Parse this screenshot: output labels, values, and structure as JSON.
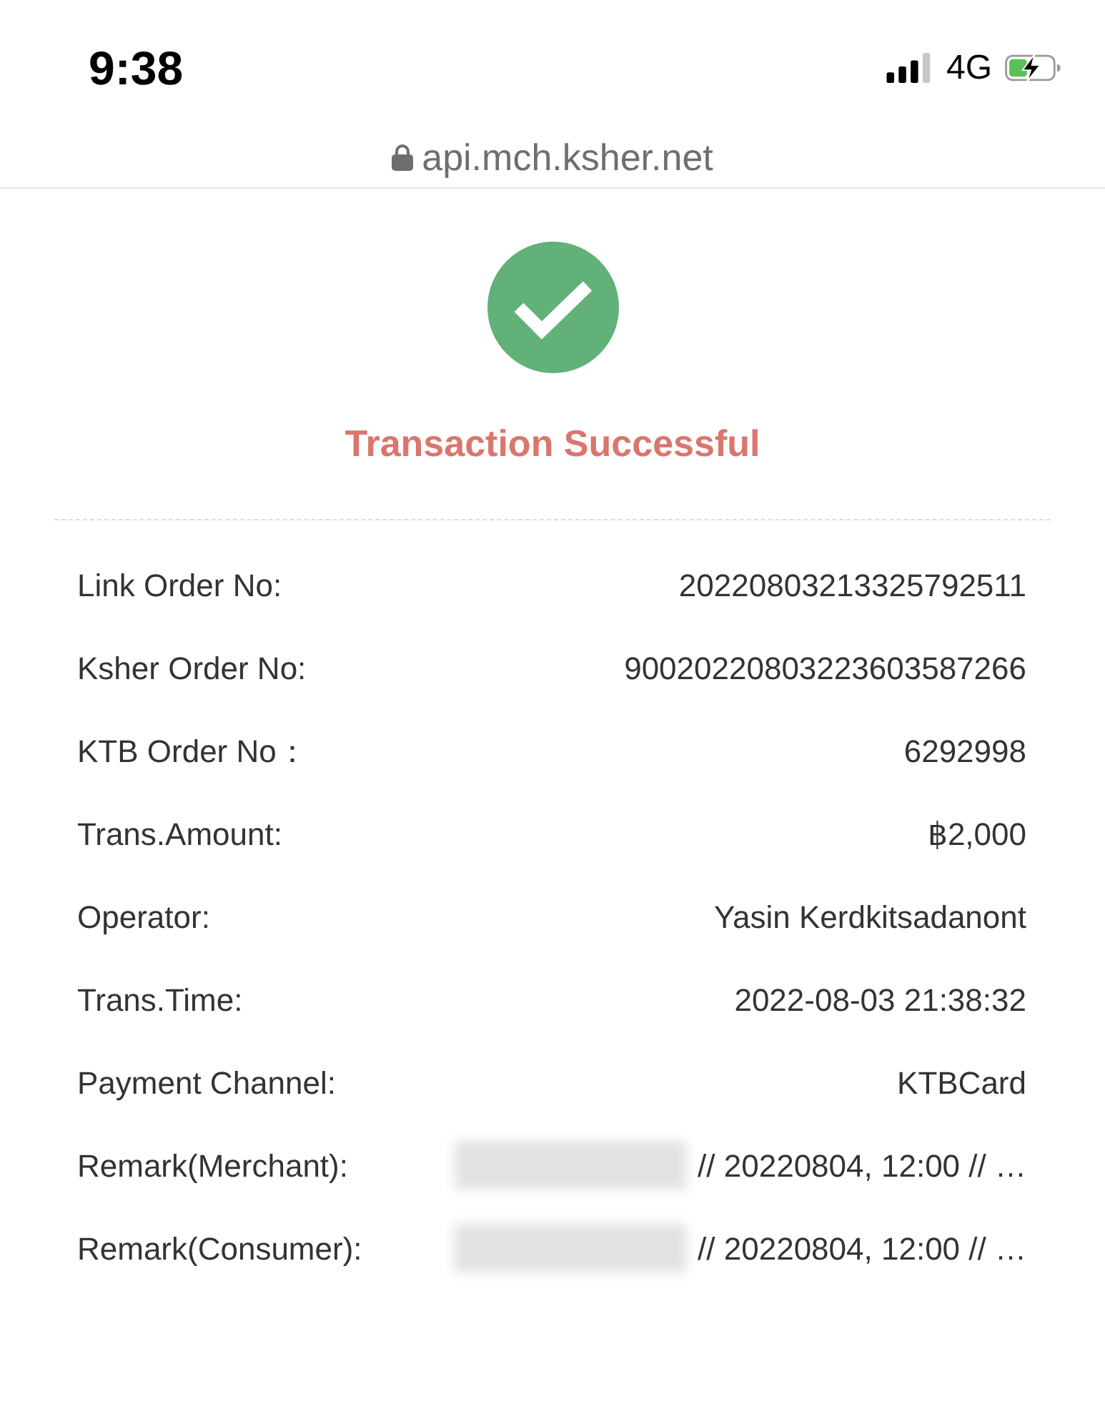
{
  "status_bar": {
    "time": "9:38",
    "network": "4G"
  },
  "address_bar": {
    "url": "api.mch.ksher.net"
  },
  "result": {
    "title": "Transaction Successful"
  },
  "details": [
    {
      "label": "Link Order No:",
      "value": "20220803213325792511",
      "redacted": false
    },
    {
      "label": "Ksher Order No:",
      "value": "90020220803223603587266",
      "redacted": false
    },
    {
      "label": "KTB Order No：",
      "value": "6292998",
      "redacted": false
    },
    {
      "label": "Trans.Amount:",
      "value": "฿2,000",
      "redacted": false
    },
    {
      "label": "Operator:",
      "value": "Yasin Kerdkitsadanont",
      "redacted": false
    },
    {
      "label": "Trans.Time:",
      "value": "2022-08-03 21:38:32",
      "redacted": false
    },
    {
      "label": "Payment Channel:",
      "value": "KTBCard",
      "redacted": false
    },
    {
      "label": "Remark(Merchant):",
      "value": "// 20220804, 12:00 // …",
      "redacted": true
    },
    {
      "label": "Remark(Consumer):",
      "value": "// 20220804, 12:00 // …",
      "redacted": true
    }
  ]
}
